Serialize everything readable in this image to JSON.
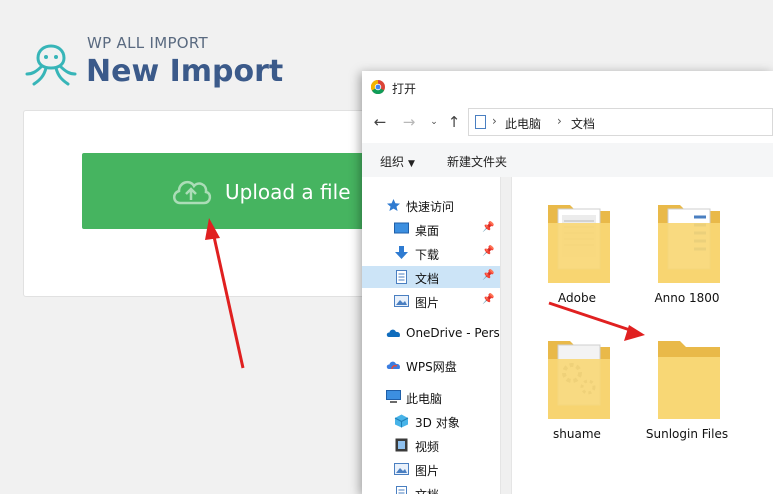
{
  "header": {
    "brand_sub": "WP ALL IMPORT",
    "brand_title": "New Import"
  },
  "upload": {
    "label": "Upload a file"
  },
  "dialog": {
    "title": "打开",
    "breadcrumb": [
      "此电脑",
      "文档"
    ],
    "toolbar": {
      "organize": "组织",
      "new_folder": "新建文件夹"
    },
    "nav_items": [
      {
        "label": "快速访问",
        "icon": "star-icon",
        "pinned": false
      },
      {
        "label": "桌面",
        "icon": "desktop-icon",
        "pinned": true
      },
      {
        "label": "下载",
        "icon": "download-icon",
        "pinned": true
      },
      {
        "label": "文档",
        "icon": "document-icon",
        "pinned": true,
        "selected": true
      },
      {
        "label": "图片",
        "icon": "picture-icon",
        "pinned": true
      },
      {
        "label": "OneDrive - Pers",
        "icon": "onedrive-icon",
        "pinned": false
      },
      {
        "label": "WPS网盘",
        "icon": "wps-cloud-icon",
        "pinned": false
      },
      {
        "label": "此电脑",
        "icon": "computer-icon",
        "pinned": false
      },
      {
        "label": "3D 对象",
        "icon": "3d-objects-icon",
        "pinned": false
      },
      {
        "label": "视频",
        "icon": "video-icon",
        "pinned": false
      },
      {
        "label": "图片",
        "icon": "picture-icon",
        "pinned": false
      },
      {
        "label": "文档",
        "icon": "document-icon",
        "pinned": false
      }
    ],
    "files": [
      {
        "name": "Adobe",
        "type": "docs-folder"
      },
      {
        "name": "Anno 1800",
        "type": "blue-docs-folder"
      },
      {
        "name": "shuame",
        "type": "gear-folder"
      },
      {
        "name": "Sunlogin Files",
        "type": "empty-folder"
      }
    ]
  },
  "colors": {
    "brand_blue": "#3b5a8a",
    "upload_green": "#46b460",
    "annotation_red": "#e02020",
    "selection_blue": "#cce4f7",
    "folder_yellow": "#f8d775"
  }
}
